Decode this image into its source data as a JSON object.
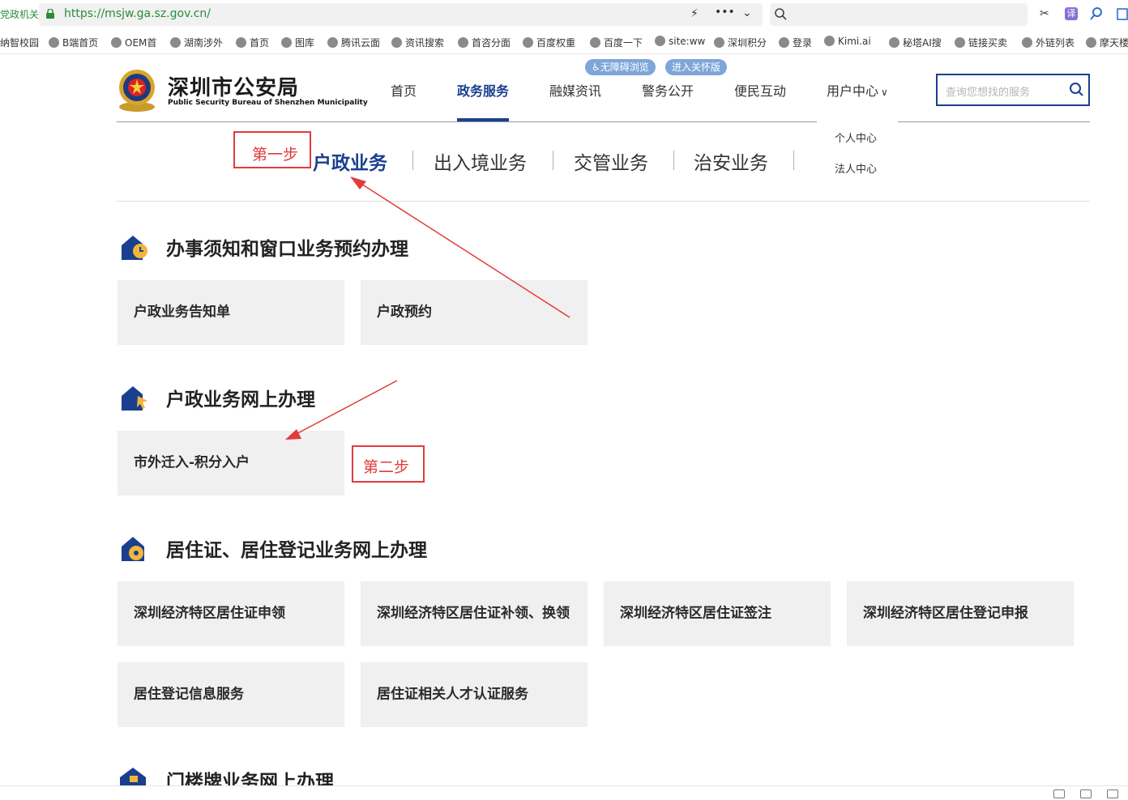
{
  "browser": {
    "site_tag": "党政机关",
    "url": "https://msjw.ga.sz.gov.cn/",
    "bookmarks": [
      "纳智校园",
      "B端首页",
      "OEM首",
      "湖南涉外",
      "首页",
      "图库",
      "腾讯云面",
      "资讯搜索",
      "首咨分面",
      "百度权重",
      "百度一下",
      "site:ww",
      "深圳积分",
      "登录",
      "Kimi.ai",
      "秘塔AI搜",
      "链接买卖",
      "外链列表",
      "摩天楼"
    ]
  },
  "header": {
    "title": "深圳市公安局",
    "subtitle": "Public Security Bureau of Shenzhen Municipality",
    "nav": [
      "首页",
      "政务服务",
      "融媒资讯",
      "警务公开",
      "便民互动",
      "用户中心"
    ],
    "accessibility": "无障碍浏览",
    "care_mode": "进入关怀版",
    "search_placeholder": "查询您想找的服务",
    "user_menu": [
      "个人中心",
      "法人中心"
    ]
  },
  "tabs": [
    "户政业务",
    "出入境业务",
    "交管业务",
    "治安业务"
  ],
  "sections": [
    {
      "title": "办事须知和窗口业务预约办理",
      "cards": [
        "户政业务告知单",
        "户政预约"
      ]
    },
    {
      "title": "户政业务网上办理",
      "cards": [
        "市外迁入-积分入户"
      ]
    },
    {
      "title": "居住证、居住登记业务网上办理",
      "cards": [
        "深圳经济特区居住证申领",
        "深圳经济特区居住证补领、换领",
        "深圳经济特区居住证签注",
        "深圳经济特区居住登记申报",
        "居住登记信息服务",
        "居住证相关人才认证服务"
      ]
    },
    {
      "title": "门楼牌业务网上办理",
      "cards": []
    }
  ],
  "annotations": {
    "step1": "第一步",
    "step2": "第二步"
  },
  "colors": {
    "primary": "#1a3f8f",
    "annotation": "#e23b3b",
    "card_bg": "#f0f0f0"
  }
}
